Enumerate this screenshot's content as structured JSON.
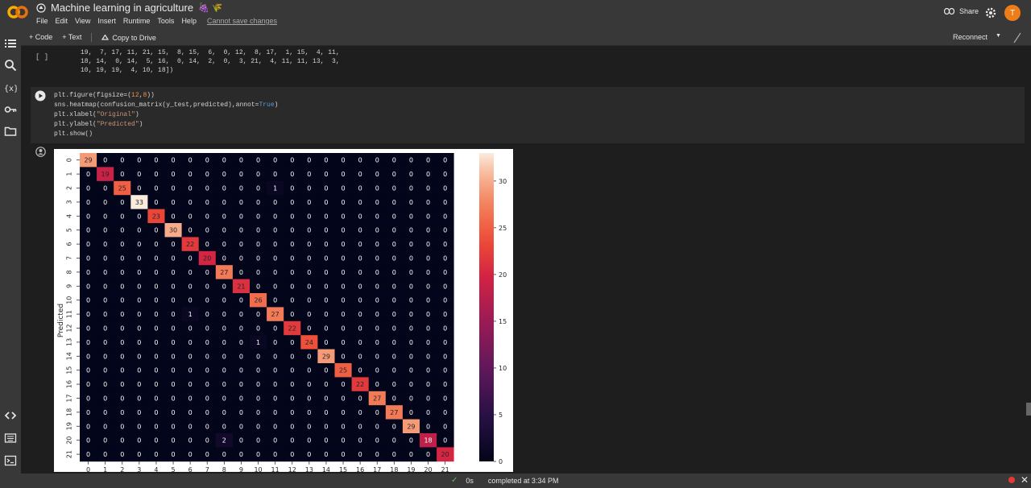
{
  "header": {
    "title": "Machine learning in agriculture",
    "title_emoji": "🍇 🌾",
    "menus": [
      "File",
      "Edit",
      "View",
      "Insert",
      "Runtime",
      "Tools",
      "Help"
    ],
    "cannot_save": "Cannot save changes",
    "share_label": "Share",
    "avatar_letter": "T",
    "colors": {
      "accent": "#ef7d17",
      "bg": "#383838"
    }
  },
  "toolbar": {
    "code_label": "+ Code",
    "text_label": "+ Text",
    "copy_label": "Copy to Drive",
    "reconnect_label": "Reconnect"
  },
  "rail": {
    "icons": [
      "toc-icon",
      "search-icon",
      "variables-icon",
      "secrets-key-icon",
      "files-folder-icon",
      "code-snippets-icon",
      "command-palette-icon",
      "terminal-icon"
    ]
  },
  "previous_output": {
    "bracket": "[ ]",
    "lines": [
      "19,  7, 17, 11, 21, 15,  8, 15,  6,  0, 12,  8, 17,  1, 15,  4, 11,",
      "18, 14,  0, 14,  5, 16,  0, 14,  2,  0,  3, 21,  4, 11, 11, 13,  3,",
      "10, 19, 19,  4, 10, 18])"
    ]
  },
  "cell": {
    "code_lines": [
      "plt.figure(figsize=(12,8))",
      "sns.heatmap(confusion_matrix(y_test,predicted),annot=True)",
      "plt.xlabel(\"Original\")",
      "plt.ylabel(\"Predicted\")",
      "plt.show()"
    ]
  },
  "status": {
    "check": "✓",
    "time": "0s",
    "completed": "completed at 3:34 PM"
  },
  "chart_data": {
    "type": "heatmap",
    "ylabel": "Predicted",
    "xlabel": "",
    "labels": [
      "0",
      "1",
      "2",
      "3",
      "4",
      "5",
      "6",
      "7",
      "8",
      "9",
      "10",
      "11",
      "12",
      "13",
      "14",
      "15",
      "16",
      "17",
      "18",
      "19",
      "20",
      "21"
    ],
    "diagonal": [
      29,
      19,
      25,
      33,
      23,
      30,
      22,
      20,
      27,
      21,
      26,
      27,
      22,
      24,
      29,
      25,
      22,
      27,
      27,
      29,
      18,
      20
    ],
    "off_diagonal": [
      {
        "row": 2,
        "col": 11,
        "value": 1
      },
      {
        "row": 11,
        "col": 6,
        "value": 1
      },
      {
        "row": 13,
        "col": 10,
        "value": 1
      },
      {
        "row": 20,
        "col": 8,
        "value": 2
      }
    ],
    "colorbar_ticks": [
      0,
      5,
      10,
      15,
      20,
      25,
      30
    ],
    "vmin": 0,
    "vmax": 33,
    "colormap": "rocket"
  }
}
